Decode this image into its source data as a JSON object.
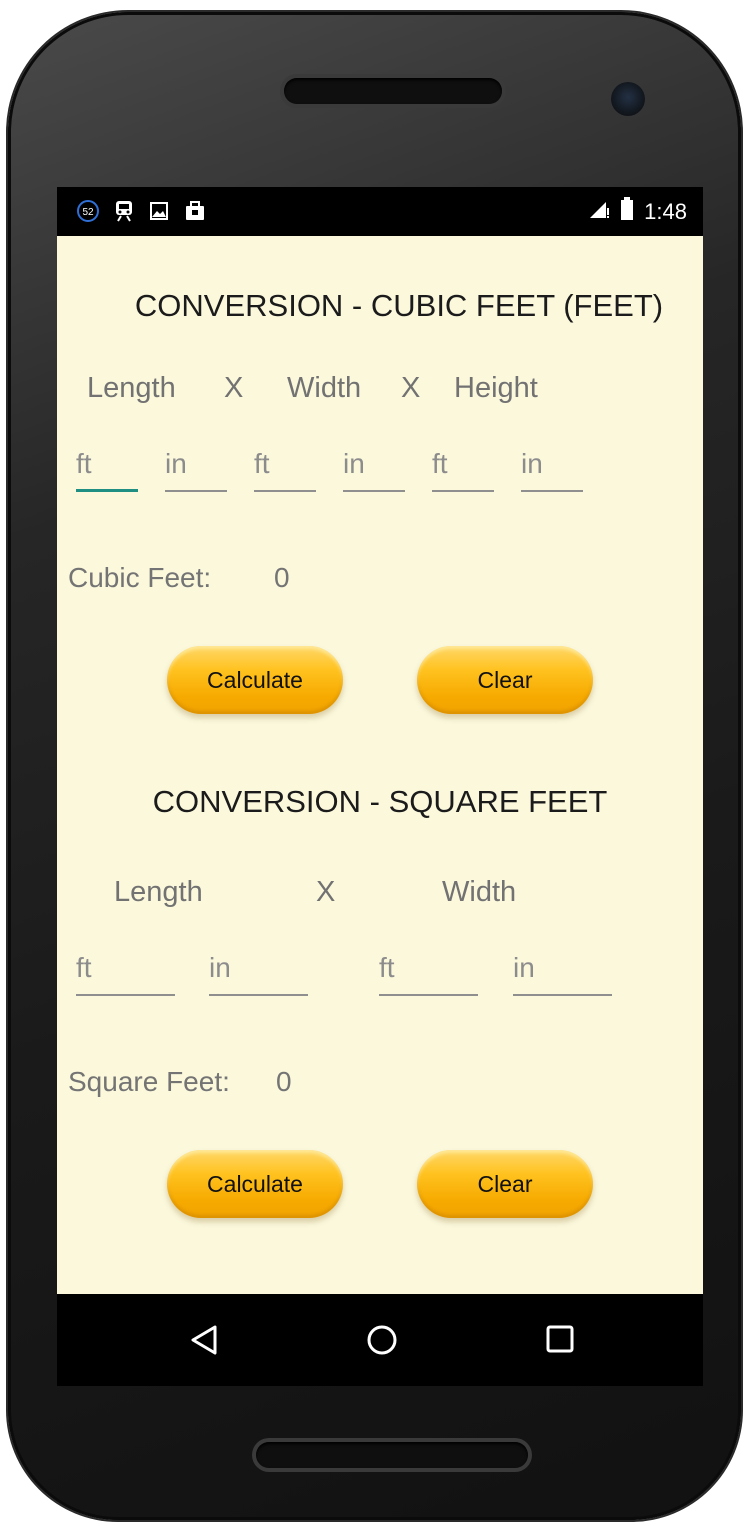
{
  "status_bar": {
    "notification_badge": "52",
    "time": "1:48",
    "icons": [
      "notification-count-icon",
      "train-icon",
      "image-icon",
      "bag-icon",
      "signal-icon",
      "battery-icon"
    ]
  },
  "cubic": {
    "title": "CONVERSION - CUBIC FEET (FEET)",
    "labels": {
      "length": "Length",
      "x1": "X",
      "width": "Width",
      "x2": "X",
      "height": "Height"
    },
    "fields": [
      {
        "placeholder": "ft",
        "value": ""
      },
      {
        "placeholder": "in",
        "value": ""
      },
      {
        "placeholder": "ft",
        "value": ""
      },
      {
        "placeholder": "in",
        "value": ""
      },
      {
        "placeholder": "ft",
        "value": ""
      },
      {
        "placeholder": "in",
        "value": ""
      }
    ],
    "result_label": "Cubic Feet:",
    "result_value": "0",
    "calculate_label": "Calculate",
    "clear_label": "Clear"
  },
  "square": {
    "title": "CONVERSION - SQUARE FEET",
    "labels": {
      "length": "Length",
      "x": "X",
      "width": "Width"
    },
    "fields": [
      {
        "placeholder": "ft",
        "value": ""
      },
      {
        "placeholder": "in",
        "value": ""
      },
      {
        "placeholder": "ft",
        "value": ""
      },
      {
        "placeholder": "in",
        "value": ""
      }
    ],
    "result_label": "Square Feet:",
    "result_value": "0",
    "calculate_label": "Calculate",
    "clear_label": "Clear"
  },
  "colors": {
    "background": "#fbf8dc",
    "button": "#ffc21f",
    "accent": "#1f8f84"
  },
  "nav_bar": {
    "icons": [
      "back-icon",
      "home-icon",
      "recents-icon"
    ]
  }
}
